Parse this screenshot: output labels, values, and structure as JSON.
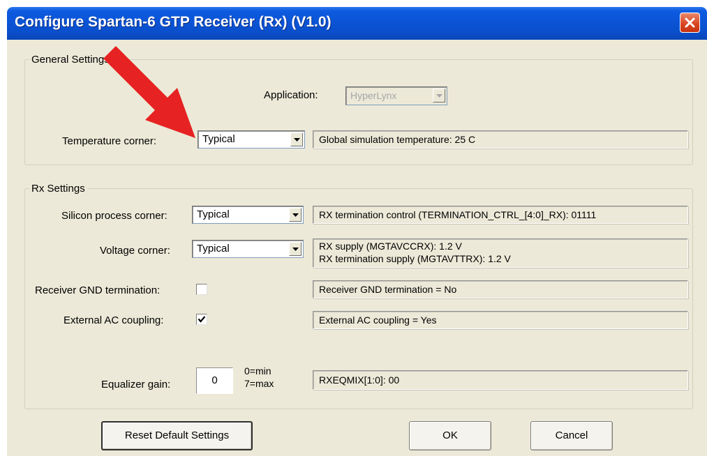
{
  "window": {
    "title": "Configure Spartan-6 GTP Receiver (Rx)   (V1.0)"
  },
  "general": {
    "legend": "General Settings",
    "application_label": "Application:",
    "application_value": "HyperLynx",
    "temperature_label": "Temperature corner:",
    "temperature_value": "Typical",
    "temperature_info": "Global simulation temperature: 25 C"
  },
  "rx": {
    "legend": "Rx Settings",
    "silicon_label": "Silicon process corner:",
    "silicon_value": "Typical",
    "silicon_info": "RX termination control (TERMINATION_CTRL_[4:0]_RX): 01111",
    "voltage_label": "Voltage corner:",
    "voltage_value": "Typical",
    "voltage_info_1": "RX supply (MGTAVCCRX): 1.2 V",
    "voltage_info_2": "RX termination supply (MGTAVTTRX): 1.2 V",
    "gnd_label": "Receiver GND termination:",
    "gnd_checked": false,
    "gnd_info": "Receiver GND termination = No",
    "ac_label": "External AC coupling:",
    "ac_checked": true,
    "ac_info": "External AC coupling = Yes",
    "eq_label": "Equalizer gain:",
    "eq_value": "0",
    "eq_min": "0=min",
    "eq_max": "7=max",
    "eq_info": "RXEQMIX[1:0]: 00"
  },
  "buttons": {
    "reset": "Reset Default Settings",
    "ok": "OK",
    "cancel": "Cancel"
  },
  "colors": {
    "titlebar": "#0b54d6",
    "dialog_bg": "#ece9d8",
    "annotation_arrow": "#e62222"
  },
  "icons": {
    "close": "close-icon",
    "dropdown": "chevron-down-icon",
    "check": "checkmark-icon",
    "annotation": "annotation-arrow"
  }
}
